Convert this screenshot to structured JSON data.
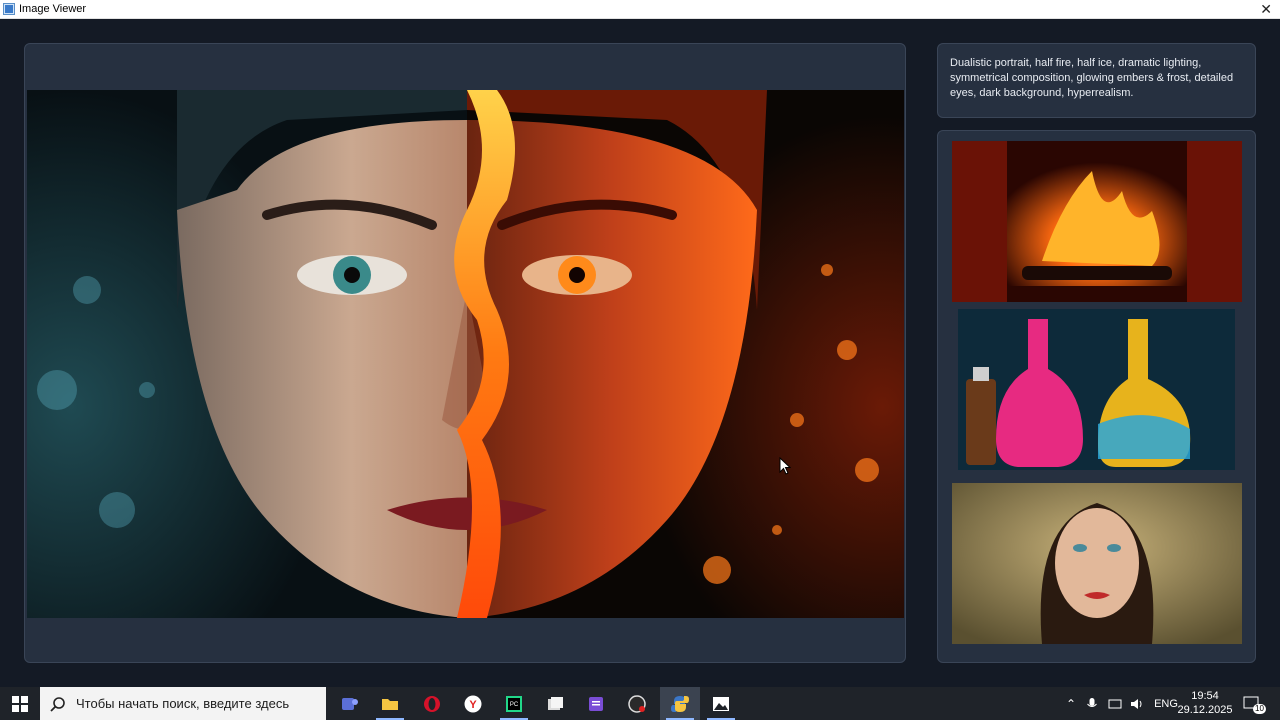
{
  "window": {
    "title": "Image Viewer",
    "close_glyph": "✕"
  },
  "prompt": {
    "text": "Dualistic portrait, half fire, half ice, dramatic lighting, symmetrical composition, glowing embers & frost, detailed eyes, dark background, hyperrealism."
  },
  "main_image": {
    "description_icon": "fire-ice-portrait-image"
  },
  "gallery": {
    "items": [
      {
        "icon": "fireplace-thumbnail"
      },
      {
        "icon": "potion-bottles-thumbnail"
      },
      {
        "icon": "woman-portrait-thumbnail"
      }
    ]
  },
  "taskbar": {
    "search_placeholder": "Чтобы начать поиск, введите здесь",
    "apps": [
      "teams-icon",
      "file-explorer-icon",
      "opera-icon",
      "yandex-browser-icon",
      "pycharm-icon",
      "files-icon",
      "notes-icon",
      "obs-icon",
      "python-icon",
      "photos-icon"
    ],
    "language": "ENG",
    "time": "19:54",
    "date": "29.12.2025",
    "notifications_count": "10"
  },
  "colors": {
    "accent": "#ff6a1a",
    "ice": "#3aa6c4",
    "panel": "#263040",
    "background": "#141a25"
  }
}
